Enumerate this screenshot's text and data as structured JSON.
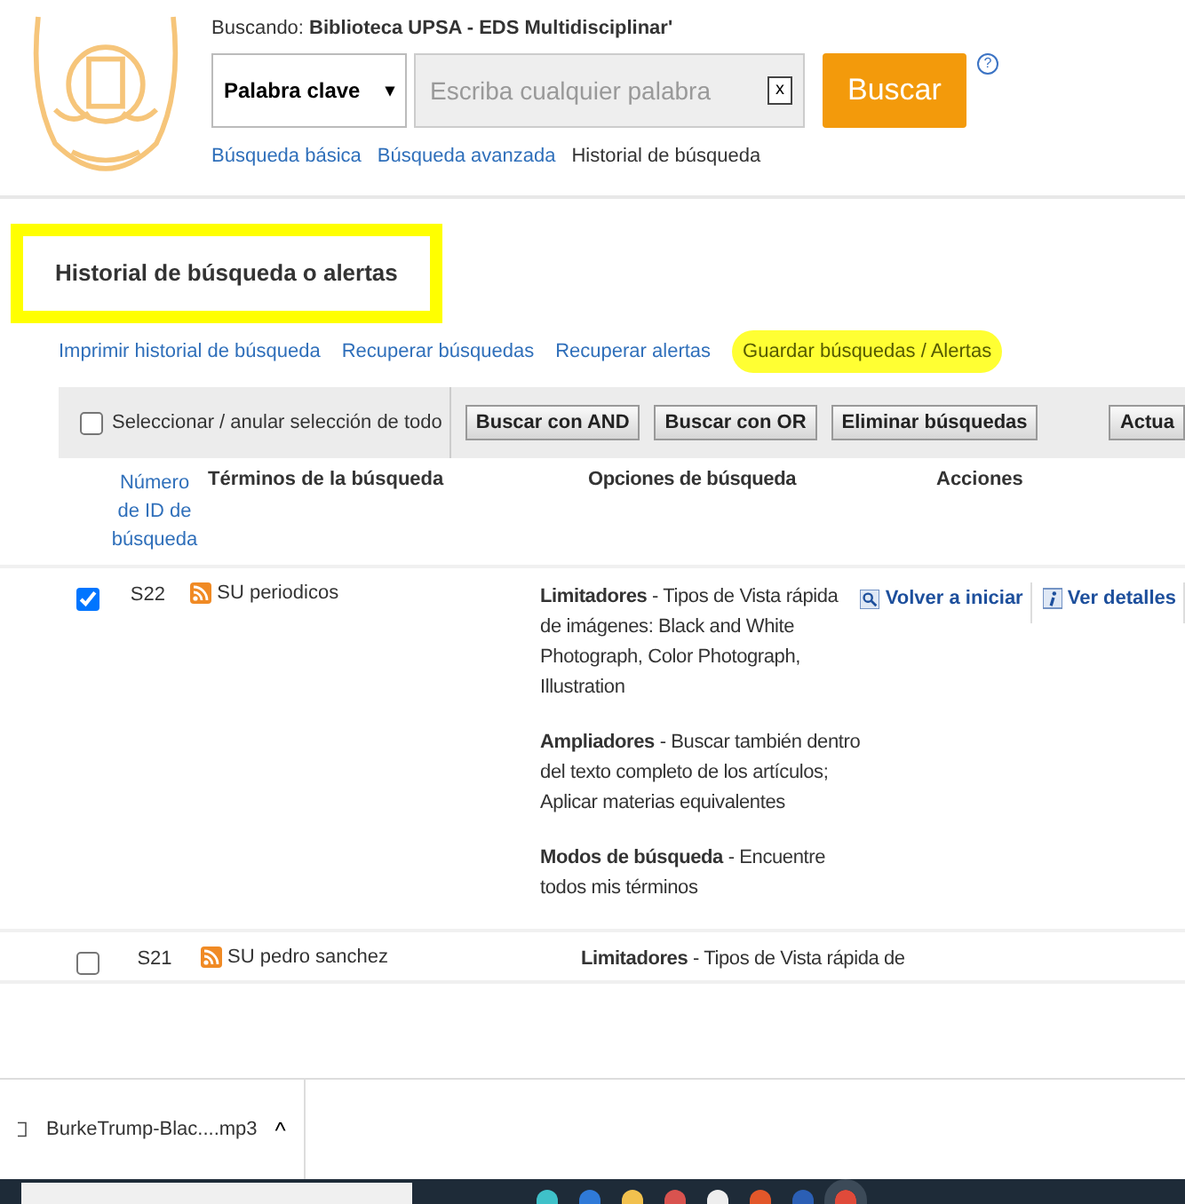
{
  "header": {
    "searching_label": "Buscando:",
    "searching_value": "Biblioteca UPSA - EDS Multidisciplinar'",
    "field_select": "Palabra clave",
    "field_caret": "▾",
    "search": {
      "placeholder": "Escriba cualquier palabra"
    },
    "clear_button": "x",
    "search_button": "Buscar",
    "help_button": "?",
    "nav_links": [
      {
        "label": "Búsqueda básica",
        "selected": false
      },
      {
        "label": "Búsqueda avanzada",
        "selected": false
      },
      {
        "label": "Historial de búsqueda",
        "selected": true
      }
    ]
  },
  "page_title": {
    "text": "Historial de búsqueda o alertas",
    "highlighted": true
  },
  "history_links": [
    {
      "label": "Imprimir historial de búsqueda",
      "highlighted": false
    },
    {
      "label": "Recuperar búsquedas",
      "highlighted": false
    },
    {
      "label": "Recuperar alertas",
      "highlighted": false
    },
    {
      "label": "Guardar búsquedas / Alertas",
      "highlighted": true
    }
  ],
  "toolbar": {
    "select_all": {
      "label": "Seleccionar / anular selección de todo",
      "checked": false
    },
    "buttons": [
      "Buscar con AND",
      "Buscar con OR",
      "Eliminar búsquedas"
    ],
    "right_button": "Actua"
  },
  "table": {
    "columns": [
      "Número de ID de búsqueda",
      "Términos de la búsqueda",
      "Opciones de búsqueda",
      "Acciones"
    ],
    "rows": [
      {
        "checked": true,
        "id": "S22",
        "terms": "SU periodicos",
        "options": [
          "**Limitadores** - Tipos de Vista rápida de imágenes: Black and White Photograph, Color Photograph, Illustration",
          "**Ampliadores** - Buscar también dentro del texto completo de los artículos; Aplicar materias equivalentes",
          "**Modos de búsqueda** - Encuentre todos mis términos"
        ],
        "actions": [
          "Volver a iniciar",
          "Ver detalles"
        ]
      },
      {
        "checked": false,
        "id": "S21",
        "terms": "SU pedro sanchez",
        "options": [
          "**Limitadores** - Tipos de Vista rápida de"
        ],
        "actions": []
      }
    ]
  },
  "download_bar": {
    "file": "BurkeTrump-Blac....mp3",
    "caret": "^"
  }
}
